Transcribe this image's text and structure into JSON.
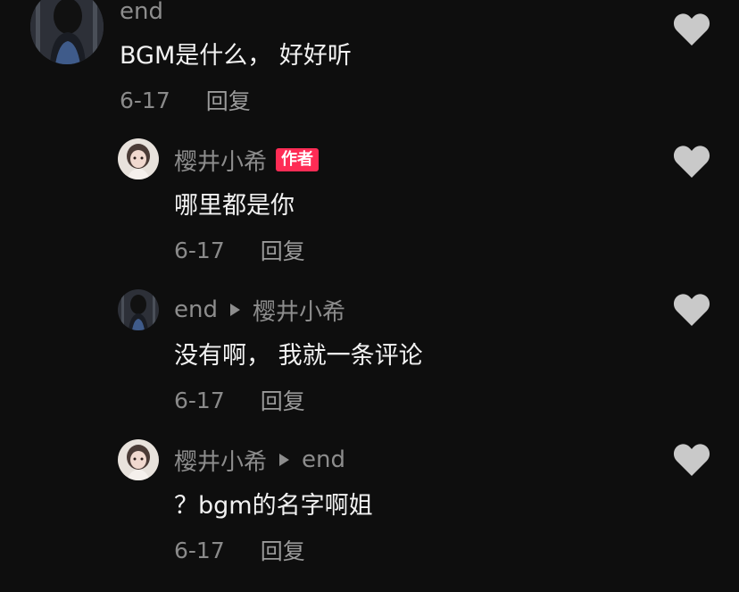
{
  "comments": [
    {
      "username": "end",
      "text": "BGM是什么， 好好听",
      "date": "6-17",
      "reply_label": "回复",
      "avatar_icon": "user-avatar-dark"
    },
    {
      "username": "樱井小希",
      "badge": "作者",
      "text": "哪里都是你",
      "date": "6-17",
      "reply_label": "回复",
      "avatar_icon": "user-avatar-light"
    },
    {
      "username": "end",
      "reply_to": "樱井小希",
      "text": "没有啊， 我就一条评论",
      "date": "6-17",
      "reply_label": "回复",
      "avatar_icon": "user-avatar-dark"
    },
    {
      "username": "樱井小希",
      "reply_to": "end",
      "text": "？bgm的名字啊姐",
      "date": "6-17",
      "reply_label": "回复",
      "avatar_icon": "user-avatar-light"
    }
  ],
  "colors": {
    "background": "#0e0e0e",
    "badge": "#fe2c55",
    "heart": "#c9c9c9"
  },
  "icons": {
    "like": "heart-icon",
    "reply_arrow": "triangle-right-icon"
  }
}
